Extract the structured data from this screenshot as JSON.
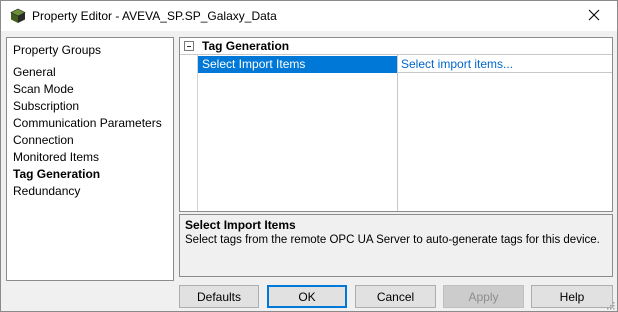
{
  "window": {
    "title": "Property Editor - AVEVA_SP.SP_Galaxy_Data",
    "icons": {
      "app": "galaxy-cube-icon",
      "close": "close-icon"
    }
  },
  "property_groups": {
    "header": "Property Groups",
    "items": [
      {
        "label": "General",
        "selected": false
      },
      {
        "label": "Scan Mode",
        "selected": false
      },
      {
        "label": "Subscription",
        "selected": false
      },
      {
        "label": "Communication Parameters",
        "selected": false
      },
      {
        "label": "Connection",
        "selected": false
      },
      {
        "label": "Monitored Items",
        "selected": false
      },
      {
        "label": "Tag Generation",
        "selected": true
      },
      {
        "label": "Redundancy",
        "selected": false
      }
    ]
  },
  "grid": {
    "category": "Tag Generation",
    "expander_symbol": "−",
    "rows": [
      {
        "name": "Select Import Items",
        "value": "Select import items..."
      }
    ]
  },
  "description": {
    "title": "Select Import Items",
    "text": "Select tags from the remote OPC UA Server to auto-generate tags for this device."
  },
  "buttons": {
    "defaults": "Defaults",
    "ok": "OK",
    "cancel": "Cancel",
    "apply": "Apply",
    "help": "Help"
  },
  "colors": {
    "selection": "#0078d7",
    "link": "#0066cc",
    "background": "#f0f0f0"
  }
}
